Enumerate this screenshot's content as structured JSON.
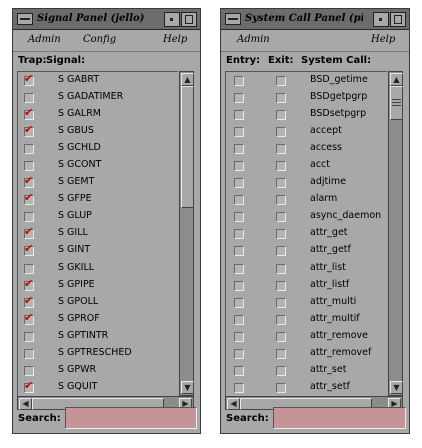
{
  "signal_panel": {
    "title": "Signal Panel (jello)",
    "menu": {
      "admin": "Admin",
      "config": "Config",
      "help": "Help"
    },
    "headers": {
      "trap": "Trap:",
      "signal": "Signal:"
    },
    "items": [
      {
        "label": "S GABRT",
        "checked": true
      },
      {
        "label": "S GADATIMER",
        "checked": false
      },
      {
        "label": "S GALRM",
        "checked": true
      },
      {
        "label": "S GBUS",
        "checked": true
      },
      {
        "label": "S GCHLD",
        "checked": false
      },
      {
        "label": "S GCONT",
        "checked": false
      },
      {
        "label": "S GEMT",
        "checked": true
      },
      {
        "label": "S GFPE",
        "checked": true
      },
      {
        "label": "S GLUP",
        "checked": false
      },
      {
        "label": "S GILL",
        "checked": true
      },
      {
        "label": "S GINT",
        "checked": true
      },
      {
        "label": "S GKILL",
        "checked": false
      },
      {
        "label": "S GPIPE",
        "checked": true
      },
      {
        "label": "S GPOLL",
        "checked": true
      },
      {
        "label": "S GPROF",
        "checked": true
      },
      {
        "label": "S GPTINTR",
        "checked": false
      },
      {
        "label": "S GPTRESCHED",
        "checked": false
      },
      {
        "label": "S GPWR",
        "checked": false
      },
      {
        "label": "S GQUIT",
        "checked": true
      }
    ],
    "search": {
      "label": "Search:",
      "value": ""
    }
  },
  "syscall_panel": {
    "title": "System Call Panel (pid",
    "menu": {
      "admin": "Admin",
      "help": "Help"
    },
    "headers": {
      "entry": "Entry:",
      "exit": "Exit:",
      "syscall": "System Call:"
    },
    "items": [
      "BSD_getime",
      "BSDgetpgrp",
      "BSDsetpgrp",
      "accept",
      "access",
      "acct",
      "adjtime",
      "alarm",
      "async_daemon",
      "attr_get",
      "attr_getf",
      "attr_list",
      "attr_listf",
      "attr_multi",
      "attr_multif",
      "attr_remove",
      "attr_removef",
      "attr_set",
      "attr_setf"
    ],
    "search": {
      "label": "Search:",
      "value": ""
    }
  },
  "colors": {
    "window_bg": "#a8a8a8",
    "check_mark": "#cc0000",
    "search_field": "#c49496"
  }
}
